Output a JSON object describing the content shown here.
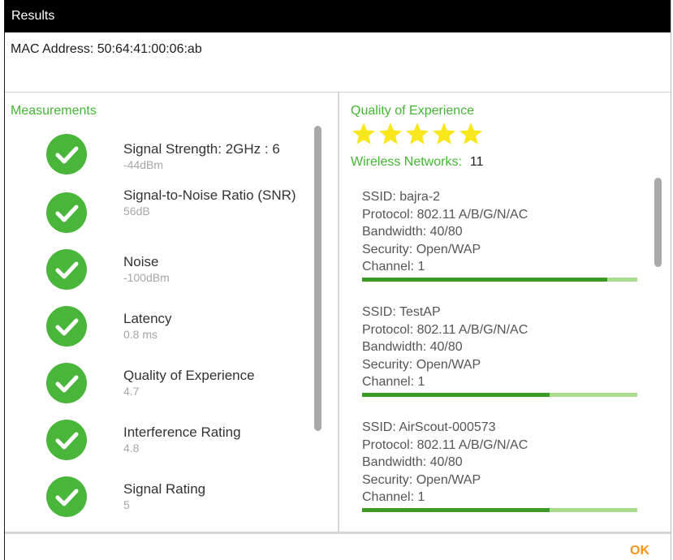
{
  "window": {
    "title": "Results"
  },
  "device": {
    "mac_text": "MAC Address: 50:64:41:00:06:ab"
  },
  "left": {
    "title": "Measurements",
    "items": [
      {
        "label": "Signal Strength: 2GHz : 6",
        "value": "-44dBm",
        "status": "pass"
      },
      {
        "label": "Signal-to-Noise Ratio (SNR)",
        "value": "56dB",
        "status": "pass"
      },
      {
        "label": "Noise",
        "value": "-100dBm",
        "status": "pass"
      },
      {
        "label": "Latency",
        "value": "0.8 ms",
        "status": "pass"
      },
      {
        "label": "Quality of Experience",
        "value": "4.7",
        "status": "pass"
      },
      {
        "label": "Interference Rating",
        "value": "4.8",
        "status": "pass"
      },
      {
        "label": "Signal Rating",
        "value": "5",
        "status": "pass"
      }
    ]
  },
  "right": {
    "qoe_title": "Quality of Experience",
    "rating": {
      "stars": 5,
      "max": 5,
      "color": "#f8e71c"
    },
    "wireless_label": "Wireless Networks:",
    "wireless_count": "11",
    "networks": [
      {
        "ssid": "SSID: bajra-2",
        "protocol": "Protocol: 802.11 A/B/G/N/AC",
        "bandwidth": "Bandwidth: 40/80",
        "security": "Security: Open/WAP",
        "channel": "Channel: 1",
        "signal_level": 0.89
      },
      {
        "ssid": "SSID: TestAP",
        "protocol": "Protocol: 802.11 A/B/G/N/AC",
        "bandwidth": "Bandwidth: 40/80",
        "security": "Security: Open/WAP",
        "channel": "Channel: 1",
        "signal_level": 0.68
      },
      {
        "ssid": "SSID: AirScout-000573",
        "protocol": "Protocol: 802.11 A/B/G/N/AC",
        "bandwidth": "Bandwidth: 40/80",
        "security": "Security: Open/WAP",
        "channel": "Channel: 1",
        "signal_level": 0.68
      }
    ]
  },
  "footer": {
    "ok_label": "OK"
  },
  "colors": {
    "accent_green": "#45b535",
    "check_green": "#49b53b",
    "ok_orange": "#f7941d",
    "bar_fill": "#3d9a26",
    "bar_track": "#a9dc8e"
  }
}
